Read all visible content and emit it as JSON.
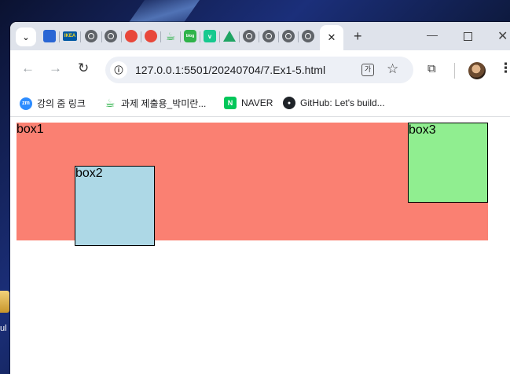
{
  "desktop": {
    "partial_label": "ul"
  },
  "browser": {
    "tabs": {
      "menu_icon": "chevron-down-icon",
      "favicons": [
        "flag-icon",
        "ikea-icon",
        "globe-icon",
        "globe-icon",
        "red-icon",
        "red-icon",
        "cup-icon",
        "blog-icon",
        "vimeo-icon",
        "drive-icon",
        "globe-icon",
        "globe-icon",
        "globe-icon",
        "globe-icon"
      ],
      "ikea_text": "IKEA",
      "blog_text": "blog",
      "vimeo_text": "v",
      "active_close": "✕",
      "new_tab": "+"
    },
    "window_controls": {
      "minimize": "—",
      "close": "✕"
    },
    "toolbar": {
      "back": "←",
      "forward": "→",
      "reload": "↻",
      "url": "127.0.0.1:5501/20240704/7.Ex1-5.html",
      "translate_icon": "translate-icon",
      "bookmark_star": "☆",
      "extensions_icon": "puzzle-icon",
      "menu": "⋮"
    },
    "bookmarks": [
      {
        "icon": "zoom-icon",
        "icon_text": "zm",
        "label": "강의 줌 링크"
      },
      {
        "icon": "cup-icon",
        "icon_text": "☕",
        "label": "과제 제출용_박미란..."
      },
      {
        "icon": "naver-icon",
        "icon_text": "N",
        "label": "NAVER"
      },
      {
        "icon": "github-icon",
        "icon_text": "●",
        "label": "GitHub: Let's build..."
      }
    ]
  },
  "page": {
    "box1": {
      "label": "box1",
      "color": "#fa8072"
    },
    "box2": {
      "label": "box2",
      "color": "#add8e6"
    },
    "box3": {
      "label": "box3",
      "color": "#90ee90"
    }
  }
}
